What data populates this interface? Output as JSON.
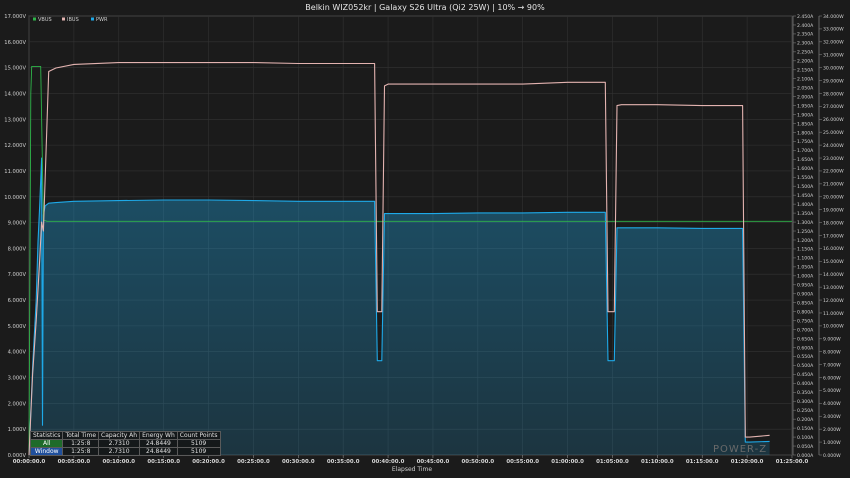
{
  "chart_data": {
    "type": "line",
    "title": "Belkin WIZ052kr | Galaxy S26 Ultra (Qi2 25W) | 10% → 90%",
    "xlabel": "Elapsed Time",
    "x_unit": "minutes",
    "xlim": [
      0,
      85
    ],
    "x_ticks": [
      "00:00:00.0",
      "00:05:00.0",
      "00:10:00.0",
      "00:15:00.0",
      "00:20:00.0",
      "00:25:00.0",
      "00:30:00.0",
      "00:35:00.0",
      "00:40:00.0",
      "00:45:00.0",
      "00:50:00.0",
      "00:55:00.0",
      "01:00:00.0",
      "01:05:00.0",
      "01:10:00.0",
      "01:15:00.0",
      "01:20:00.0",
      "01:25:00.0"
    ],
    "left_axis": {
      "ylim": [
        0,
        17
      ],
      "ticks": [
        "0.000V",
        "1.000V",
        "2.000V",
        "3.000V",
        "4.000V",
        "5.000V",
        "6.000V",
        "7.000V",
        "8.000V",
        "9.000V",
        "10.000V",
        "11.000V",
        "12.000V",
        "13.000V",
        "14.000V",
        "15.000V",
        "16.000V",
        "17.000V"
      ]
    },
    "right_axis_1": {
      "ylim": [
        0,
        2.45
      ],
      "ticks": [
        "0.000A",
        "0.050A",
        "0.100A",
        "0.150A",
        "0.200A",
        "0.250A",
        "0.300A",
        "0.350A",
        "0.400A",
        "0.450A",
        "0.500A",
        "0.550A",
        "0.600A",
        "0.650A",
        "0.700A",
        "0.750A",
        "0.800A",
        "0.850A",
        "0.900A",
        "0.950A",
        "1.000A",
        "1.050A",
        "1.100A",
        "1.150A",
        "1.200A",
        "1.250A",
        "1.300A",
        "1.350A",
        "1.400A",
        "1.450A",
        "1.500A",
        "1.550A",
        "1.600A",
        "1.650A",
        "1.700A",
        "1.750A",
        "1.800A",
        "1.850A",
        "1.900A",
        "1.950A",
        "2.000A",
        "2.050A",
        "2.100A",
        "2.150A",
        "2.200A",
        "2.250A",
        "2.300A",
        "2.350A",
        "2.400A",
        "2.450A"
      ]
    },
    "right_axis_2": {
      "ylim": [
        0,
        34
      ],
      "ticks": [
        "0.000W",
        "1.000W",
        "2.000W",
        "3.000W",
        "4.000W",
        "5.000W",
        "6.000W",
        "7.000W",
        "8.000W",
        "9.000W",
        "10.000W",
        "11.000W",
        "12.000W",
        "13.000W",
        "14.000W",
        "15.000W",
        "16.000W",
        "17.000W",
        "18.000W",
        "19.000W",
        "20.000W",
        "21.000W",
        "22.000W",
        "23.000W",
        "24.000W",
        "25.000W",
        "26.000W",
        "27.000W",
        "28.000W",
        "29.000W",
        "30.000W",
        "31.000W",
        "32.000W",
        "33.000W",
        "34.000W"
      ]
    },
    "legend_position": "top-left",
    "series": [
      {
        "name": "VBUS",
        "axis": "left",
        "color": "#2fb54a",
        "x": [
          0,
          0.2,
          0.3,
          0.8,
          1.3,
          1.6,
          2.0,
          5,
          20,
          40,
          60,
          80,
          85
        ],
        "y": [
          0,
          14.0,
          15.05,
          15.05,
          15.05,
          9.1,
          9.05,
          9.05,
          9.05,
          9.05,
          9.05,
          9.05,
          9.05
        ]
      },
      {
        "name": "IBUS",
        "axis": "right_1",
        "color": "#e3b3b0",
        "x": [
          0,
          0.4,
          0.8,
          1.2,
          1.4,
          1.6,
          1.8,
          2.2,
          3,
          5,
          10,
          15,
          20,
          25,
          30,
          35,
          38.5,
          38.8,
          39.3,
          39.6,
          40,
          45,
          50,
          55,
          60,
          64.2,
          64.5,
          65.2,
          65.5,
          66,
          70,
          75,
          79.5,
          79.8,
          80.3,
          82.5
        ],
        "y": [
          0,
          0.45,
          0.75,
          1.1,
          1.3,
          1.25,
          1.55,
          2.14,
          2.16,
          2.18,
          2.19,
          2.19,
          2.19,
          2.19,
          2.185,
          2.185,
          2.185,
          0.8,
          0.8,
          2.06,
          2.07,
          2.07,
          2.07,
          2.07,
          2.08,
          2.08,
          0.8,
          0.8,
          1.95,
          1.955,
          1.955,
          1.95,
          1.95,
          0.1,
          0.1,
          0.11
        ]
      },
      {
        "name": "PWR",
        "axis": "right_2",
        "color": "#1ea9e8",
        "x": [
          0,
          0.4,
          0.8,
          1.0,
          1.2,
          1.4,
          1.5,
          1.6,
          1.8,
          2.2,
          3,
          5,
          10,
          15,
          20,
          25,
          30,
          35,
          38.5,
          38.8,
          39.3,
          39.6,
          40,
          45,
          50,
          55,
          60,
          64.2,
          64.5,
          65.2,
          65.5,
          66,
          70,
          75,
          79.5,
          79.8,
          80.3,
          82.5
        ],
        "y": [
          0,
          6.8,
          12,
          16.5,
          19.5,
          23,
          2.3,
          18.6,
          19.3,
          19.5,
          19.55,
          19.65,
          19.7,
          19.75,
          19.75,
          19.7,
          19.65,
          19.65,
          19.65,
          7.3,
          7.3,
          18.7,
          18.7,
          18.7,
          18.75,
          18.75,
          18.8,
          18.8,
          7.3,
          7.3,
          17.6,
          17.6,
          17.6,
          17.55,
          17.55,
          1.0,
          1.0,
          1.05
        ]
      }
    ]
  },
  "stats_table": {
    "headers": [
      "Statistics",
      "Total Time",
      "Capacity Ah",
      "Energy Wh",
      "Count Points"
    ],
    "rows": [
      [
        "All",
        "1:25:8",
        "2.7310",
        "24.8449",
        "5109"
      ],
      [
        "Window",
        "1:25:8",
        "2.7310",
        "24.8449",
        "5109"
      ]
    ]
  },
  "watermark": "POWER-Z"
}
